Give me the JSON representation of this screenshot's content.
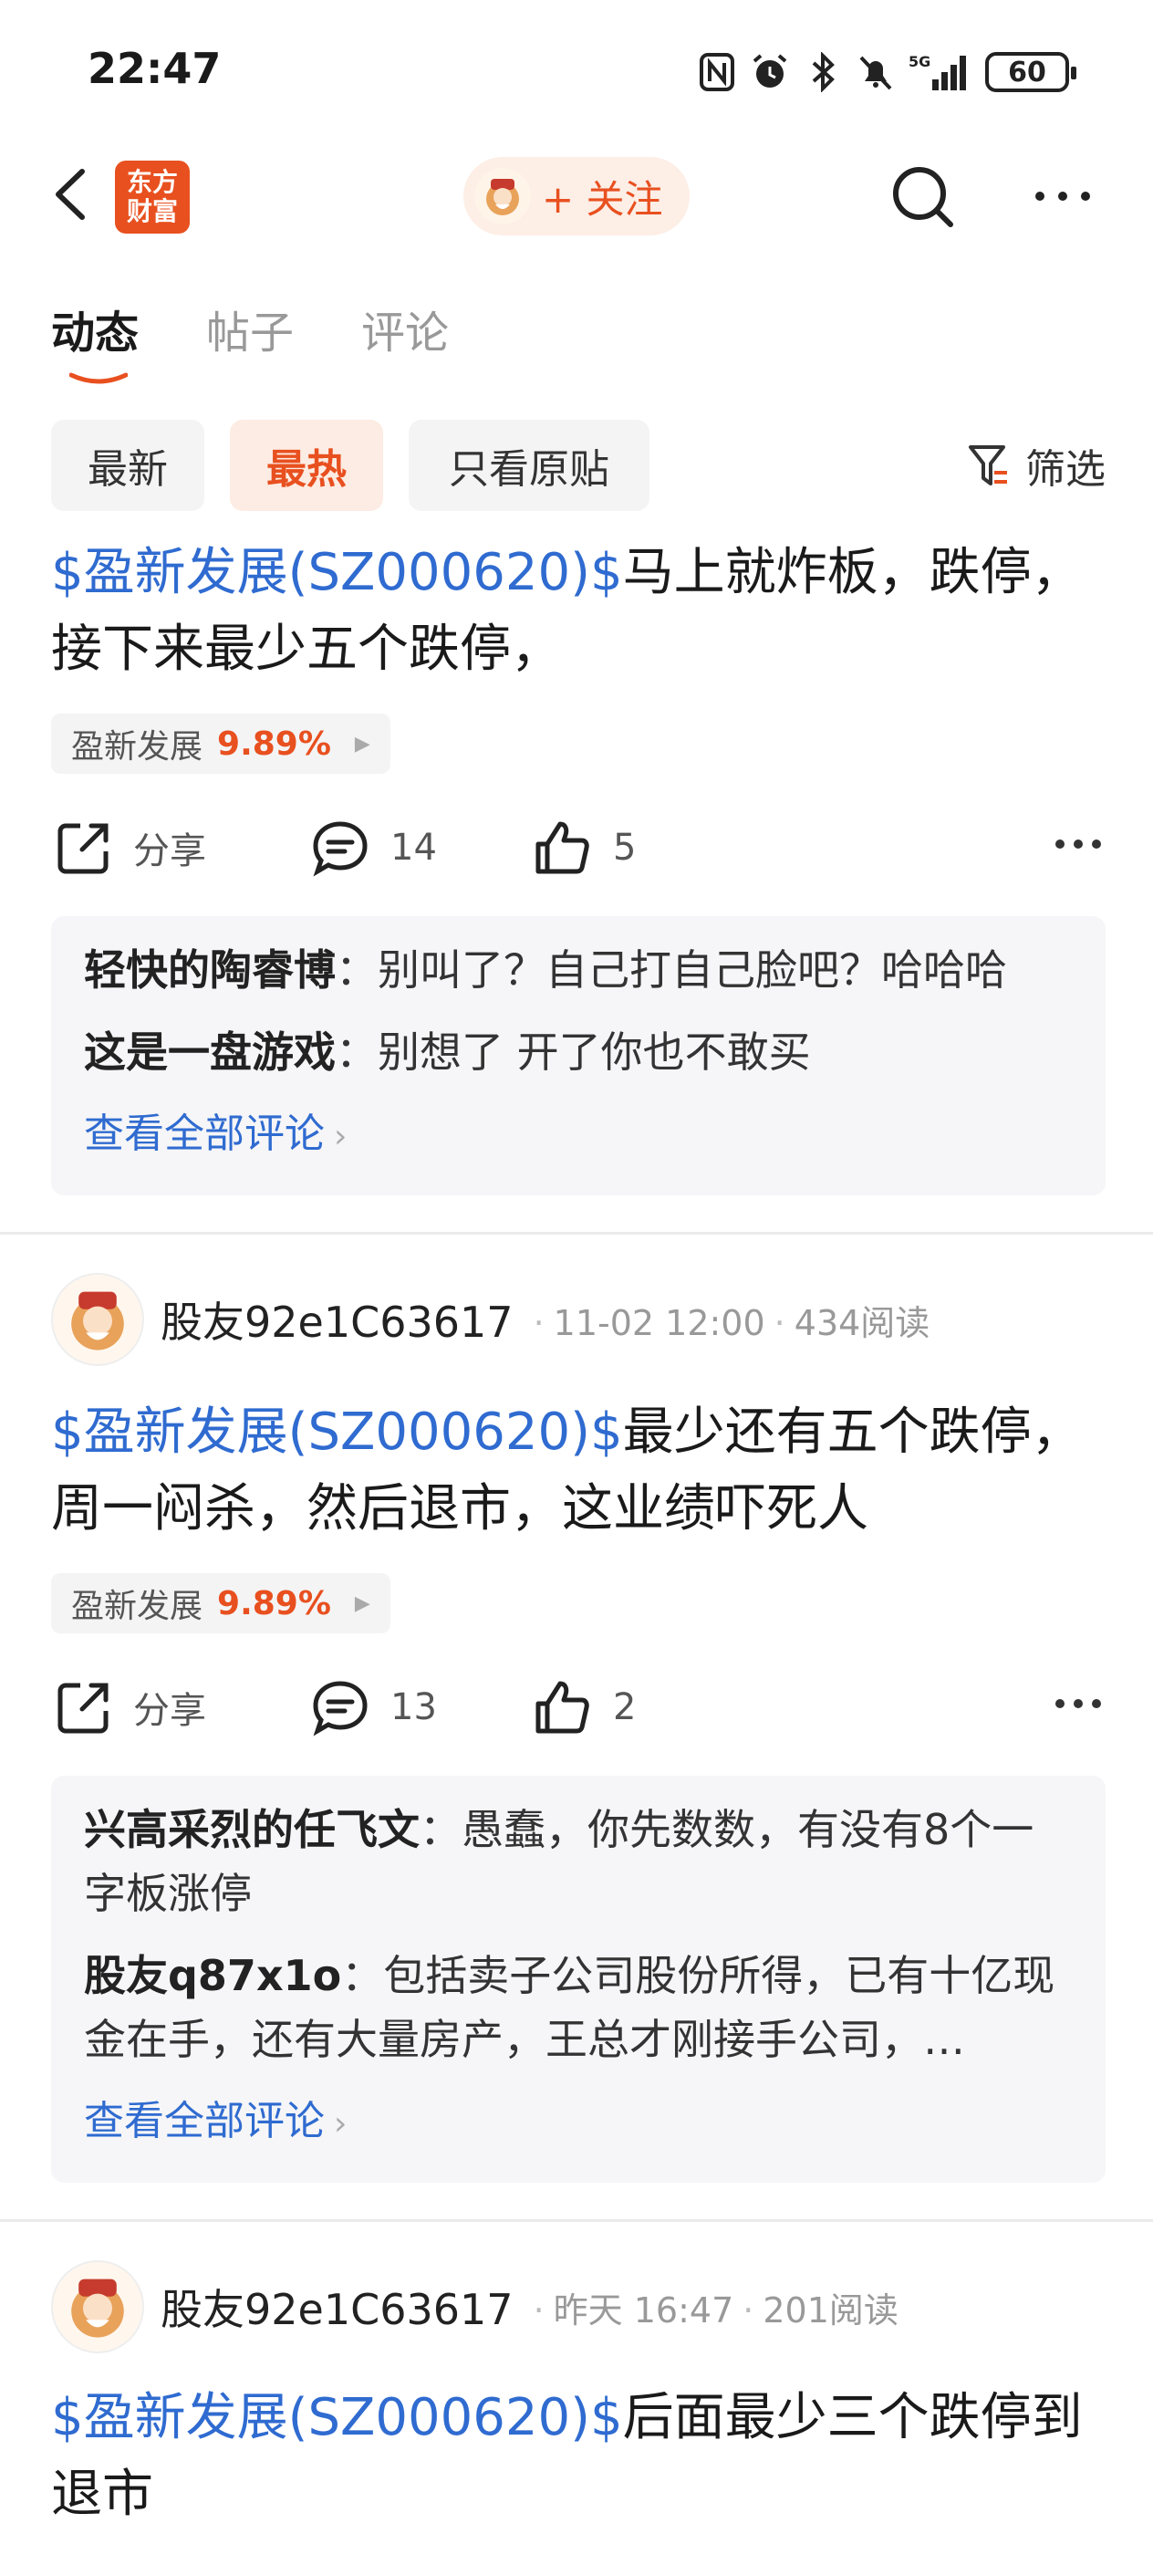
{
  "status_bar": {
    "time": "22:47",
    "icons": [
      "nfc-icon",
      "alarm-icon",
      "bluetooth-icon",
      "mute-icon",
      "5g-signal-icon"
    ],
    "battery": "60"
  },
  "nav": {
    "logo_line1": "东方",
    "logo_line2": "财富",
    "follow_label": "+ 关注"
  },
  "tabs": [
    "动态",
    "帖子",
    "评论"
  ],
  "filters": {
    "chips": [
      "最新",
      "最热",
      "只看原贴"
    ],
    "filter_label": "筛选"
  },
  "posts": [
    {
      "stock_link": "$盈新发展(SZ000620)$",
      "text": "马上就炸板，跌停，接下来最少五个跌停，",
      "tag_name": "盈新发展",
      "tag_pct": "9.89%",
      "share_label": "分享",
      "comment_count": "14",
      "like_count": "5",
      "comments": [
        {
          "author": "轻快的陶睿博",
          "text": "别叫了？自己打自己脸吧？哈哈哈"
        },
        {
          "author": "这是一盘游戏",
          "text": "别想了 开了你也不敢买"
        }
      ],
      "view_all": "查看全部评论"
    },
    {
      "user": "股友92e1C63617",
      "time": "11-02 12:00",
      "reads": "434阅读",
      "stock_link": "$盈新发展(SZ000620)$",
      "text": "最少还有五个跌停，周一闷杀，然后退市，这业绩吓死人",
      "tag_name": "盈新发展",
      "tag_pct": "9.89%",
      "share_label": "分享",
      "comment_count": "13",
      "like_count": "2",
      "comments": [
        {
          "author": "兴高采烈的任飞文",
          "text": "愚蠢，你先数数，有没有8个一字板涨停"
        },
        {
          "author": "股友q87x1o",
          "text": "包括卖子公司股份所得，已有十亿现金在手，还有大量房产，王总才刚接手公司，…"
        }
      ],
      "view_all": "查看全部评论"
    },
    {
      "user": "股友92e1C63617",
      "time": "昨天 16:47",
      "reads": "201阅读",
      "stock_link": "$盈新发展(SZ000620)$",
      "text": "后面最少三个跌停到退市"
    }
  ]
}
